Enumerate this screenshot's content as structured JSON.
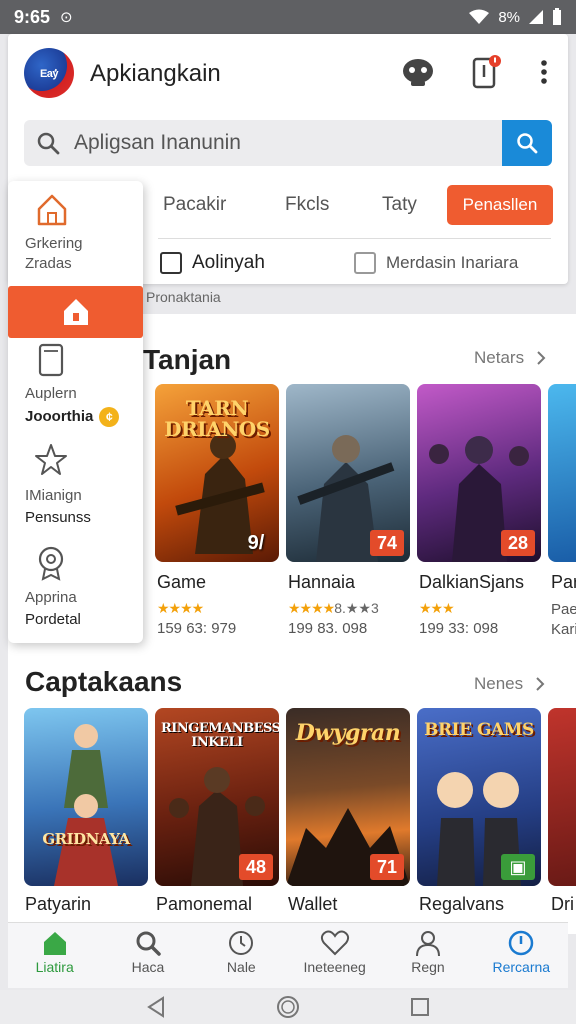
{
  "status_bar": {
    "time": "9:65",
    "signal_text": "8%"
  },
  "header": {
    "logo_text": "Eaۢy",
    "app_title": "Apkiangkain",
    "search_placeholder": "Apligsan Inanunin",
    "tabs": [
      "Pacakir",
      "Fkcls",
      "Taty"
    ],
    "active_tab": "Penasllen",
    "checkboxes": [
      {
        "label": "Aolinyah",
        "checked": false
      },
      {
        "label": "Merdasin Inariara",
        "checked": false
      }
    ],
    "under_label": "Pronaktania"
  },
  "drawer": {
    "items": [
      {
        "line1": "Grkering",
        "line2": "Zradas",
        "icon": "home-outline-icon"
      },
      {
        "line1": "",
        "line2": "",
        "icon": "home-filled-icon"
      },
      {
        "line1": "Auplern",
        "line2": "Jooorthia",
        "icon": "tablet-icon"
      },
      {
        "line1": "IMianign",
        "line2": "Pensunss",
        "icon": "star-outline-icon"
      },
      {
        "line1": "Apprina",
        "line2": "Pordetal",
        "icon": "award-icon"
      }
    ]
  },
  "sections": [
    {
      "title": "Tanjan",
      "more": "Netars",
      "games": [
        {
          "art": "TARN DRIANOS",
          "badge": "9/",
          "name": "Game",
          "stars": "★★★★",
          "stars_extra": "",
          "meta": "159 63: 979"
        },
        {
          "art": "",
          "badge": "74",
          "name": "Hannaia",
          "stars": "★★★★",
          "stars_extra": "8.★★3",
          "meta": "199 83. 098"
        },
        {
          "art": "",
          "badge": "28",
          "name": "DalkianSjans",
          "stars": "★★★",
          "stars_extra": "",
          "meta": "199 33: 098"
        },
        {
          "art": "",
          "badge": "",
          "name": "Par",
          "stars": "",
          "stars_extra": "",
          "meta": "Pae Kari"
        }
      ]
    },
    {
      "title": "Captakaans",
      "more": "Nenes",
      "games": [
        {
          "art": "GRIDNAYA",
          "badge": "",
          "name": "Patyarin",
          "meta": ""
        },
        {
          "art": "RINGEMANBESSE INKELI",
          "badge": "48",
          "name": "Pamonemal",
          "meta": ""
        },
        {
          "art": "Dwygran",
          "badge": "71",
          "name": "Wallet",
          "meta": ""
        },
        {
          "art": "BRIE GAMS",
          "badge": "",
          "name": "Regalvans",
          "meta": ""
        },
        {
          "art": "",
          "badge": "",
          "name": "Dri",
          "meta": ""
        }
      ]
    }
  ],
  "bottom_nav": [
    "Liatira",
    "Haca",
    "Nale",
    "Ineteeneg",
    "Regn",
    "Rercarna"
  ],
  "colors": {
    "accent": "#ef5c30",
    "search_button": "#1a8ad8",
    "star": "#f3a10b",
    "badge": "#e34b2a"
  }
}
